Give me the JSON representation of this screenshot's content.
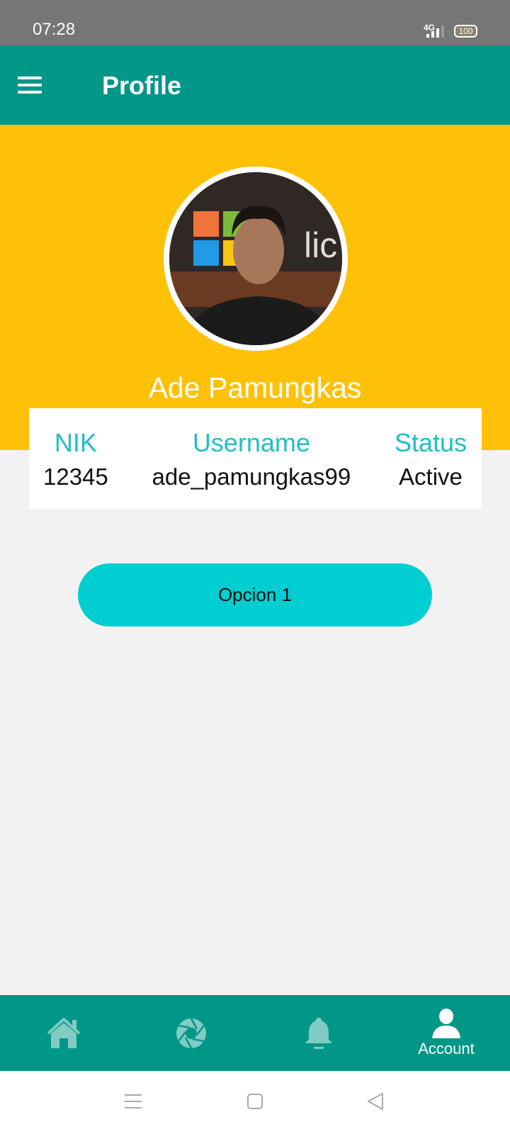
{
  "status_bar": {
    "time": "07:28",
    "network": "4G",
    "battery": "100"
  },
  "app_bar": {
    "title": "Profile",
    "menu_icon": "hamburger-menu-icon"
  },
  "profile": {
    "name": "Ade Pamungkas",
    "fields": [
      {
        "label": "NIK",
        "value": "12345"
      },
      {
        "label": "Username",
        "value": "ade_pamungkas99"
      },
      {
        "label": "Status",
        "value": "Active"
      }
    ]
  },
  "actions": {
    "option1_label": "Opcion 1"
  },
  "bottom_nav": {
    "items": [
      {
        "icon": "home-icon",
        "label": ""
      },
      {
        "icon": "camera-aperture-icon",
        "label": ""
      },
      {
        "icon": "bell-icon",
        "label": ""
      },
      {
        "icon": "person-icon",
        "label": "Account",
        "active": true
      }
    ]
  },
  "colors": {
    "primary": "#009688",
    "hero": "#ffc107",
    "accent": "#00ced1",
    "label": "#1fbfc6"
  }
}
